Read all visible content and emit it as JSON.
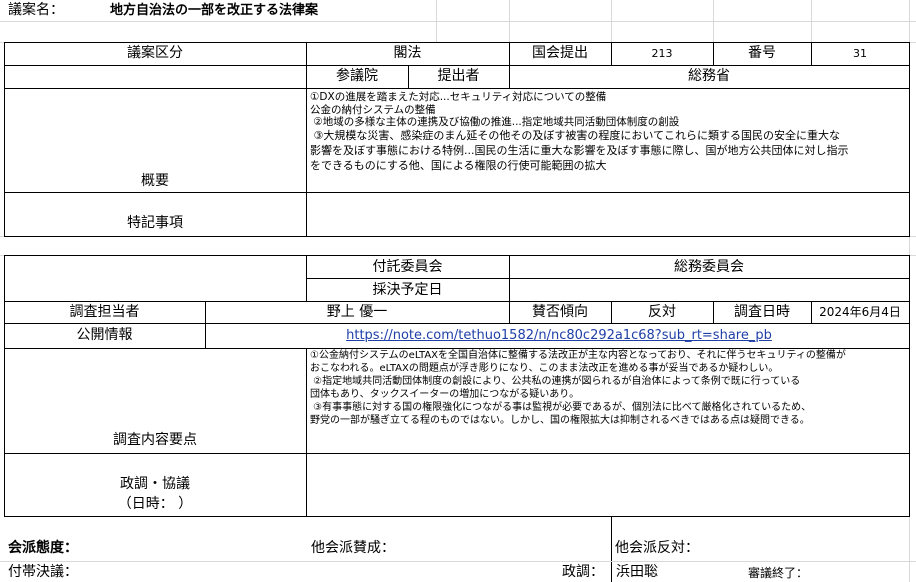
{
  "header": {
    "label": "議案名：",
    "title": "地方自治法の一部を改正する法律案"
  },
  "bill": {
    "category_label": "議案区分",
    "category_value": "閣法",
    "session_label": "国会提出",
    "session_value": "213",
    "number_label": "番号",
    "number_value": "31",
    "house_label": "参議院",
    "submitter_label": "提出者",
    "submitter_value": "総務省",
    "summary_label": "概要",
    "summary_lines": [
      "①DXの進展を踏まえた対応...セキュリティ対応についての整備",
      "公金の納付システムの整備",
      " ②地域の多様な主体の連携及び協働の推進...指定地域共同活動団体制度の創設",
      " ③大規模な災害、感染症のまん延その他その及ぼす被害の程度においてこれらに類する国民の安全に重大な",
      "影響を及ぼす事態における特例...国民の生活に重大な影響を及ぼす事態に際し、国が地方公共団体に対し指示",
      "をできるものにする他、国による権限の行使可能範囲の拡大"
    ],
    "notes_label": "特記事項"
  },
  "research": {
    "committee_label": "付託委員会",
    "committee_value": "総務委員会",
    "vote_date_label": "採決予定日",
    "staff_label": "調査担当者",
    "staff_value": "野上 優一",
    "stance_label": "賛否傾向",
    "stance_value": "反対",
    "date_label": "調査日時",
    "date_value": "2024年6月4日",
    "public_label": "公開情報",
    "public_link": "https://note.com/tethuo1582/n/nc80c292a1c68?sub_rt=share_pb",
    "points_label": "調査内容要点",
    "points_lines": [
      "①公金納付システムのeLTAXを全国自治体に整備する法改正が主な内容となっており、それに伴うセキュリティの整備が",
      "おこなわれる。eLTAXの問題点が浮き彫りになり、このまま法改正を進める事が妥当であるか疑わしい。",
      " ②指定地域共同活動団体制度の創設により、公共私の連携が図られるが自治体によって条例で既に行っている",
      "団体もあり、タックスイーターの増加につながる疑いあり。",
      " ③有事事態に対する国の権限強化につながる事は監視が必要であるが、個別法に比べて厳格化されているため、",
      "野党の一部が騒ぎ立てる程のものではない。しかし、国の権限拡大は抑制されるべきではある点は疑問できる。"
    ],
    "policy_label": "政調・協議",
    "policy_date_label": "（日時：     ）"
  },
  "footer": {
    "party_stance_label": "会派態度：",
    "other_agree_label": "他会派賛成：",
    "other_oppose_label": "他会派反対：",
    "attached_resolution_label": "付帯決議：",
    "policy_person_label": "政調：",
    "policy_person_value": "浜田聡",
    "deliberation_end_label": "審議終了："
  }
}
